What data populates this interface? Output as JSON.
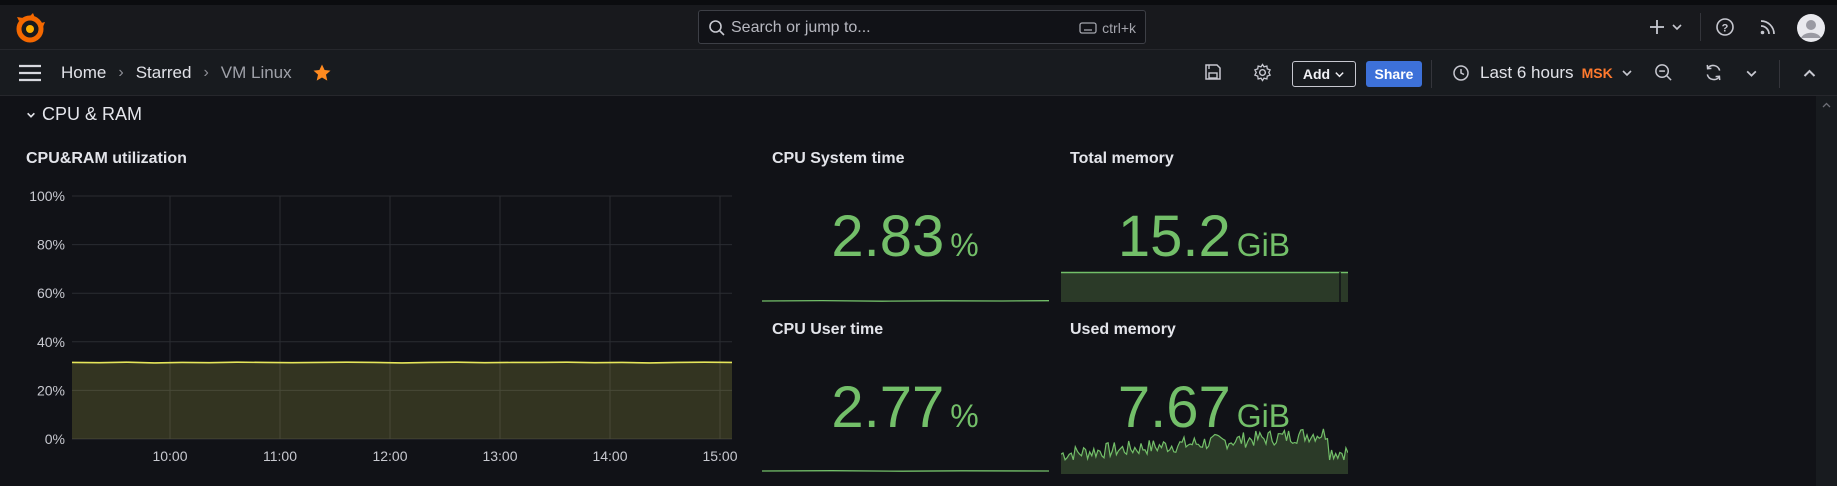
{
  "topbar": {
    "search_placeholder": "Search or jump to...",
    "search_shortcut": "ctrl+k",
    "icons": [
      "grafana-logo",
      "search-icon",
      "keyboard-icon",
      "plus-icon",
      "help-icon",
      "rss-icon",
      "avatar"
    ]
  },
  "navbar": {
    "breadcrumbs": [
      "Home",
      "Starred",
      "VM Linux"
    ],
    "add_label": "Add",
    "share_label": "Share",
    "time_range": "Last 6 hours",
    "timezone": "MSK"
  },
  "row": {
    "title": "CPU & RAM"
  },
  "panels": {
    "cpu_ram": {
      "title": "CPU&RAM utilization"
    },
    "cpu_system": {
      "title": "CPU System time",
      "value": "2.83",
      "unit": "%"
    },
    "total_memory": {
      "title": "Total memory",
      "value": "15.2",
      "unit": "GiB"
    },
    "cpu_user": {
      "title": "CPU User time",
      "value": "2.77",
      "unit": "%"
    },
    "used_memory": {
      "title": "Used memory",
      "value": "7.67",
      "unit": "GiB"
    }
  },
  "colors": {
    "background": "#111217",
    "stat_green": "#73bf69",
    "series_yellow": "#e6e65a",
    "share_blue": "#3d71d9",
    "timezone_orange": "#ff7a2e"
  },
  "chart_data": {
    "type": "area",
    "title": "CPU&RAM utilization",
    "x_ticks": [
      "10:00",
      "11:00",
      "12:00",
      "13:00",
      "14:00",
      "15:00"
    ],
    "y_ticks": [
      "0%",
      "20%",
      "40%",
      "60%",
      "80%",
      "100%"
    ],
    "ylim": [
      0,
      100
    ],
    "grid": true,
    "series": [
      {
        "values": [
          31.5,
          31.4,
          31.6,
          31.3,
          31.5,
          31.4,
          31.6,
          31.5,
          31.4,
          31.5,
          31.6,
          31.5,
          31.3,
          31.5,
          31.6,
          31.4,
          31.5,
          31.5,
          31.6,
          31.4,
          31.5,
          31.3,
          31.5,
          31.6,
          31.5
        ]
      }
    ]
  }
}
